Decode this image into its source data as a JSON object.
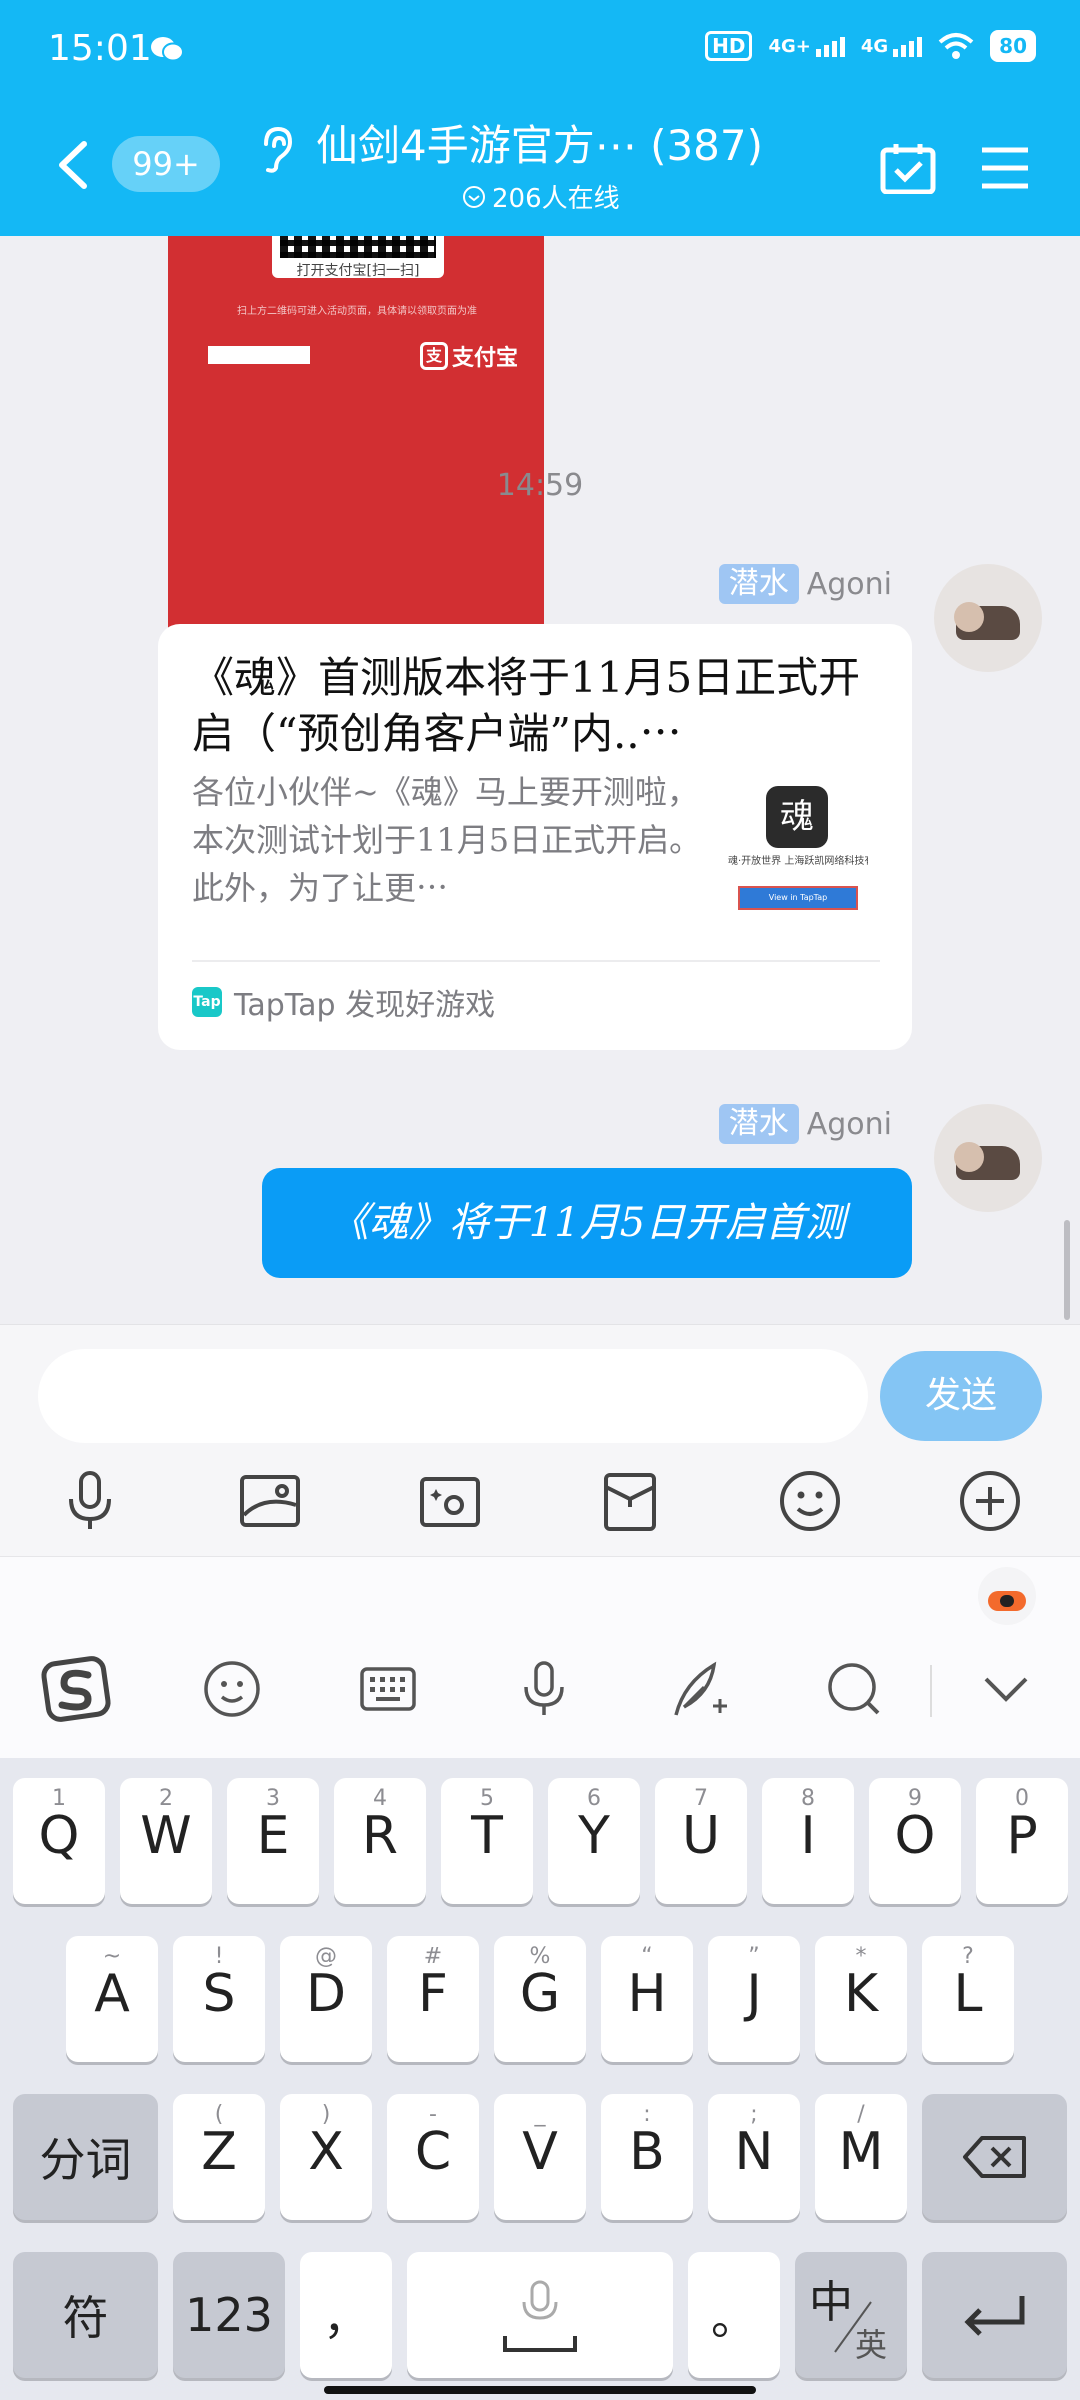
{
  "status_bar": {
    "time": "15:01",
    "hd": "HD",
    "network1": "4G+",
    "network2": "4G",
    "battery": "80"
  },
  "header": {
    "unread_badge": "99+",
    "title": "仙剑4手游官方⋯ (387)",
    "online": "206人在线"
  },
  "chat": {
    "shared_card": {
      "qr_caption": "打开支付宝[扫一扫]",
      "tiny_text": "扫上方二维码可进入活动页面，具体请以领取页面为准",
      "brand": "支付宝"
    },
    "timestamp": "14:59",
    "messages": [
      {
        "sender_tag": "潜水",
        "sender_name": "Agoni",
        "link_title": "《魂》首测版本将于11月5日正式开启（“预创角客户端”内..⋯",
        "link_desc": "各位小伙伴~《魂》马上要开测啦，本次测试计划于11月5日正式开启。此外，为了让更⋯",
        "thumb_logo": "魂",
        "thumb_name": "魂·开放世界 上海跃凯网络科技有限公司 for #",
        "thumb_btn": "View in TapTap",
        "source_icon": "Tap",
        "source": "TapTap 发现好游戏"
      },
      {
        "sender_tag": "潜水",
        "sender_name": "Agoni",
        "text": "《魂》将于11月5日开启首测"
      }
    ]
  },
  "composer": {
    "input_value": "",
    "send_label": "发送",
    "tools": [
      "mic-icon",
      "image-icon",
      "camera-icon",
      "red-packet-icon",
      "emoji-icon",
      "plus-icon"
    ]
  },
  "keyboard": {
    "row1": [
      {
        "hint": "1",
        "key": "Q"
      },
      {
        "hint": "2",
        "key": "W"
      },
      {
        "hint": "3",
        "key": "E"
      },
      {
        "hint": "4",
        "key": "R"
      },
      {
        "hint": "5",
        "key": "T"
      },
      {
        "hint": "6",
        "key": "Y"
      },
      {
        "hint": "7",
        "key": "U"
      },
      {
        "hint": "8",
        "key": "I"
      },
      {
        "hint": "9",
        "key": "O"
      },
      {
        "hint": "0",
        "key": "P"
      }
    ],
    "row2": [
      {
        "hint": "~",
        "key": "A"
      },
      {
        "hint": "!",
        "key": "S"
      },
      {
        "hint": "@",
        "key": "D"
      },
      {
        "hint": "#",
        "key": "F"
      },
      {
        "hint": "%",
        "key": "G"
      },
      {
        "hint": "“",
        "key": "H"
      },
      {
        "hint": "”",
        "key": "J"
      },
      {
        "hint": "*",
        "key": "K"
      },
      {
        "hint": "?",
        "key": "L"
      }
    ],
    "row3": [
      {
        "hint": "(",
        "key": "Z"
      },
      {
        "hint": ")",
        "key": "X"
      },
      {
        "hint": "-",
        "key": "C"
      },
      {
        "hint": "_",
        "key": "V"
      },
      {
        "hint": ":",
        "key": "B"
      },
      {
        "hint": ";",
        "key": "N"
      },
      {
        "hint": "/",
        "key": "M"
      }
    ],
    "fenci": "分词",
    "symbols": "符",
    "numbers": "123",
    "comma": "，",
    "period": "。",
    "lang_main": "中",
    "lang_sub": "英"
  }
}
